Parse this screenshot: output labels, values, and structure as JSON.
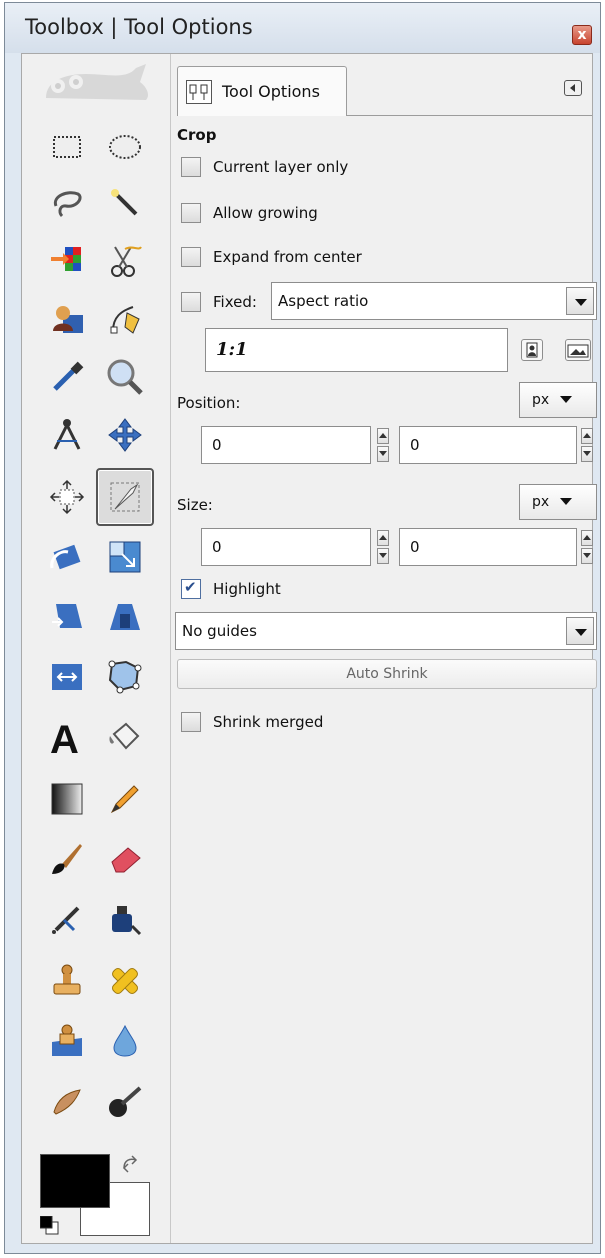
{
  "window": {
    "title": "Toolbox | Tool Options",
    "close_label": "x"
  },
  "toolbox": {
    "tools": [
      {
        "name": "rect-select-tool",
        "icon": "rectangle-select-icon"
      },
      {
        "name": "ellipse-select-tool",
        "icon": "ellipse-select-icon"
      },
      {
        "name": "free-select-tool",
        "icon": "lasso-icon"
      },
      {
        "name": "fuzzy-select-tool",
        "icon": "magic-wand-icon"
      },
      {
        "name": "select-by-color-tool",
        "icon": "color-select-icon"
      },
      {
        "name": "scissors-select-tool",
        "icon": "scissors-icon"
      },
      {
        "name": "foreground-select-tool",
        "icon": "foreground-select-icon"
      },
      {
        "name": "paths-tool",
        "icon": "pen-path-icon"
      },
      {
        "name": "color-picker-tool",
        "icon": "eyedropper-icon"
      },
      {
        "name": "zoom-tool",
        "icon": "magnifier-icon"
      },
      {
        "name": "measure-tool",
        "icon": "compass-icon"
      },
      {
        "name": "move-tool",
        "icon": "move-arrows-icon"
      },
      {
        "name": "align-tool",
        "icon": "align-icon"
      },
      {
        "name": "crop-tool",
        "icon": "crop-knife-icon"
      },
      {
        "name": "rotate-tool",
        "icon": "rotate-icon"
      },
      {
        "name": "scale-tool",
        "icon": "scale-icon"
      },
      {
        "name": "shear-tool",
        "icon": "shear-icon"
      },
      {
        "name": "perspective-tool",
        "icon": "perspective-icon"
      },
      {
        "name": "flip-tool",
        "icon": "flip-icon"
      },
      {
        "name": "cage-transform-tool",
        "icon": "cage-icon"
      },
      {
        "name": "text-tool",
        "icon": "text-a-icon"
      },
      {
        "name": "bucket-fill-tool",
        "icon": "paint-bucket-icon"
      },
      {
        "name": "blend-tool",
        "icon": "gradient-icon"
      },
      {
        "name": "pencil-tool",
        "icon": "pencil-icon"
      },
      {
        "name": "paintbrush-tool",
        "icon": "paintbrush-icon"
      },
      {
        "name": "eraser-tool",
        "icon": "eraser-icon"
      },
      {
        "name": "airbrush-tool",
        "icon": "airbrush-icon"
      },
      {
        "name": "ink-tool",
        "icon": "ink-icon"
      },
      {
        "name": "clone-tool",
        "icon": "clone-stamp-icon"
      },
      {
        "name": "heal-tool",
        "icon": "bandage-icon"
      },
      {
        "name": "perspective-clone-tool",
        "icon": "perspective-clone-icon"
      },
      {
        "name": "blur-sharpen-tool",
        "icon": "water-drop-icon"
      },
      {
        "name": "smudge-tool",
        "icon": "smudge-icon"
      },
      {
        "name": "dodge-burn-tool",
        "icon": "dodge-burn-icon"
      }
    ],
    "colors": {
      "foreground": "#000000",
      "background": "#ffffff"
    }
  },
  "tool_options": {
    "tab_label": "Tool Options",
    "section": "Crop",
    "current_layer_only": {
      "label": "Current layer only",
      "checked": false
    },
    "allow_growing": {
      "label": "Allow growing",
      "checked": false
    },
    "expand_from_center": {
      "label": "Expand from center",
      "checked": false
    },
    "fixed": {
      "label": "Fixed:",
      "checked": false,
      "value": "Aspect ratio"
    },
    "ratio": "1:1",
    "position": {
      "label": "Position:",
      "unit": "px",
      "x": "0",
      "y": "0"
    },
    "size": {
      "label": "Size:",
      "unit": "px",
      "w": "0",
      "h": "0"
    },
    "highlight": {
      "label": "Highlight",
      "checked": true
    },
    "guides": "No guides",
    "auto_shrink": "Auto Shrink",
    "shrink_merged": {
      "label": "Shrink merged",
      "checked": false
    }
  },
  "accent_colors": {
    "close": "#c8442f",
    "check": "#2a4f8f"
  }
}
